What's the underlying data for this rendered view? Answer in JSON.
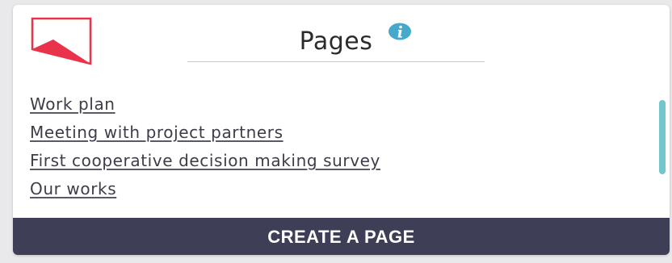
{
  "header": {
    "title": "Pages",
    "info_icon": "info-icon",
    "logo_icon": "flag-logo-icon"
  },
  "pages": [
    {
      "label": "Work plan"
    },
    {
      "label": "Meeting with project partners"
    },
    {
      "label": "First cooperative decision making survey"
    },
    {
      "label": "Our works"
    }
  ],
  "actions": {
    "create_label": "CREATE A PAGE"
  },
  "colors": {
    "brand_red": "#e8334a",
    "info_blue": "#45a9cc",
    "scroll_teal": "#73c6cc",
    "button_bg": "#3e3f56"
  }
}
